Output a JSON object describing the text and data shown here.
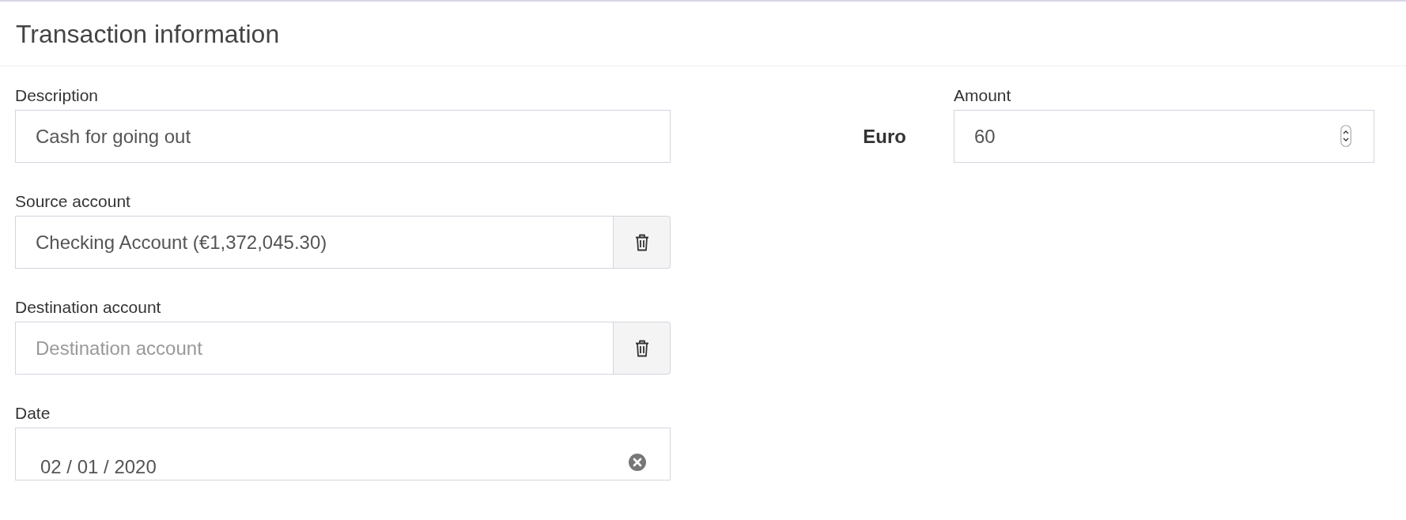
{
  "header": {
    "title": "Transaction information"
  },
  "fields": [
    {
      "kind": "text",
      "label": "Description",
      "value": "Cash for going out"
    },
    {
      "kind": "account",
      "label": "Source account",
      "value": "Checking Account (€1,372,045.30)"
    },
    {
      "kind": "account",
      "label": "Destination account",
      "placeholder": "Destination account"
    },
    {
      "kind": "date",
      "label": "Date",
      "value": "02 / 01 / 2020"
    }
  ],
  "amount": {
    "currency": "Euro",
    "label": "Amount",
    "value": "60"
  }
}
